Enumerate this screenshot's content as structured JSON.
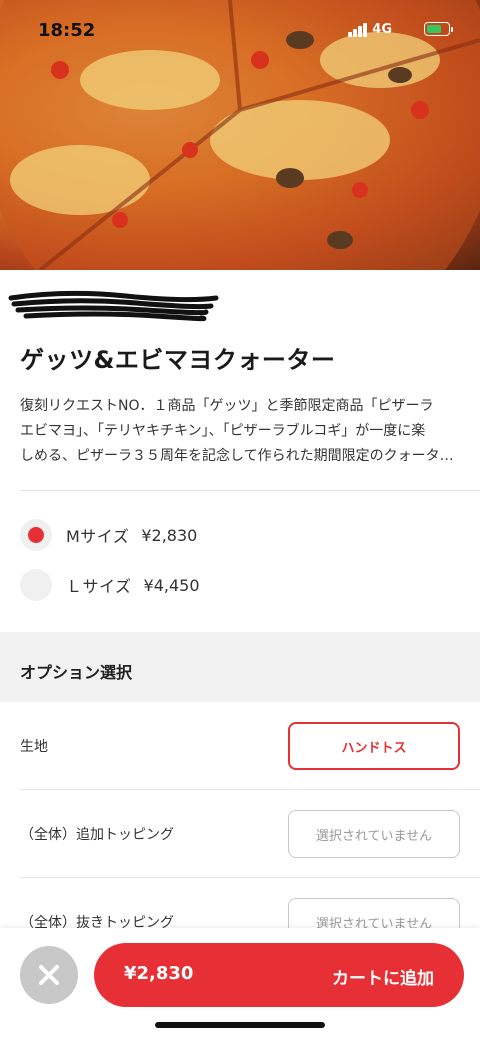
{
  "status_bar": {
    "time": "18:52",
    "network": "4G"
  },
  "product": {
    "title": "ゲッツ&エビマヨクォーター",
    "description_lines": [
      "復刻リクエストNO．１商品「ゲッツ」と季節限定商品「ピザーラ",
      "エビマヨ」、「テリヤキチキン」、「ピザーラブルコギ」が一度に楽",
      "しめる、ピザーラ３５周年を記念して作られた期間限定のクォータ…"
    ]
  },
  "sizes": [
    {
      "label": "Mサイズ",
      "price": "¥2,830",
      "selected": true
    },
    {
      "label": "Ｌサイズ",
      "price": "¥4,450",
      "selected": false
    }
  ],
  "options": {
    "heading": "オプション選択",
    "rows": [
      {
        "label": "生地",
        "value": "ハンドトス",
        "active": true
      },
      {
        "label": "（全体）追加トッピング",
        "value": "選択されていません",
        "active": false
      },
      {
        "label": "（全体）抜きトッピング",
        "value": "選択されていません",
        "active": false
      }
    ]
  },
  "footer": {
    "price": "¥2,830",
    "add_label": "カートに追加"
  },
  "colors": {
    "accent": "#e63035",
    "section_bg": "#f2f2f2"
  },
  "icons": {
    "close": "close-icon",
    "signal": "signal-icon",
    "battery": "battery-icon"
  }
}
